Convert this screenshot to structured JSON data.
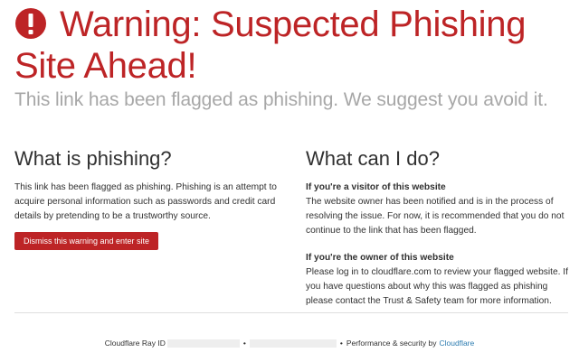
{
  "colors": {
    "accent": "#bd2426",
    "link": "#2c7cb0",
    "subtitle": "#a7a7a7"
  },
  "header": {
    "icon": "exclamation-circle-icon",
    "title_line1": "Warning: Suspected Phishing",
    "title_line2": "Site Ahead!",
    "subtitle": "This link has been flagged as phishing. We suggest you avoid it."
  },
  "left": {
    "heading": "What is phishing?",
    "body": "This link has been flagged as phishing. Phishing is an attempt to acquire personal information such as passwords and credit card details by pretending to be a trustworthy source.",
    "button_label": "Dismiss this warning and enter site"
  },
  "right": {
    "heading": "What can I do?",
    "visitor_heading": "If you're a visitor of this website",
    "visitor_body": "The website owner has been notified and is in the process of resolving the issue. For now, it is recommended that you do not continue to the link that has been flagged.",
    "owner_heading": "If you're the owner of this website",
    "owner_body": "Please log in to cloudflare.com to review your flagged website. If you have questions about why this was flagged as phishing please contact the Trust & Safety team for more information."
  },
  "footer": {
    "ray_label": "Cloudflare Ray ID",
    "separator": "•",
    "perf_label": "Performance & security by",
    "cf_link": "Cloudflare"
  }
}
